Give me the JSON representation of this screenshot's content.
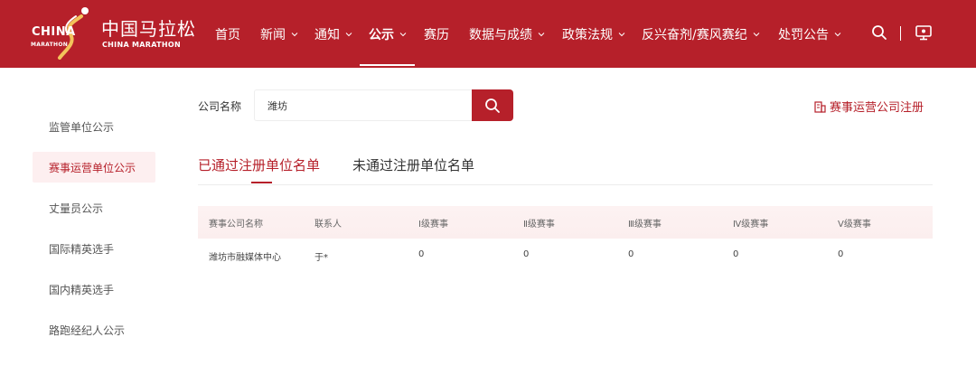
{
  "header": {
    "logo": {
      "text_top": "CHINA",
      "text_bottom": "MARATHON"
    },
    "brand_cn": "中国马拉松",
    "brand_en": "CHINA MARATHON",
    "nav": [
      {
        "label": "首页",
        "chevron": false
      },
      {
        "label": "新闻",
        "chevron": true
      },
      {
        "label": "通知",
        "chevron": true
      },
      {
        "label": "公示",
        "chevron": true,
        "active": true
      },
      {
        "label": "赛历",
        "chevron": false
      },
      {
        "label": "数据与成绩",
        "chevron": true
      },
      {
        "label": "政策法规",
        "chevron": true
      },
      {
        "label": "反兴奋剂/赛风赛纪",
        "chevron": true
      },
      {
        "label": "处罚公告",
        "chevron": true
      }
    ],
    "icons": {
      "search": "search-icon",
      "monitor": "monitor-icon"
    },
    "colors": {
      "brand": "#b6202a"
    }
  },
  "sidebar": {
    "items": [
      {
        "label": "监管单位公示"
      },
      {
        "label": "赛事运营单位公示",
        "active": true
      },
      {
        "label": "丈量员公示"
      },
      {
        "label": "国际精英选手"
      },
      {
        "label": "国内精英选手"
      },
      {
        "label": "路跑经纪人公示"
      }
    ]
  },
  "search": {
    "label": "公司名称",
    "value": "潍坊"
  },
  "register_link": "赛事运营公司注册",
  "tabs": [
    {
      "label": "已通过注册单位名单",
      "active": true
    },
    {
      "label": "未通过注册单位名单"
    }
  ],
  "table": {
    "headers": [
      "赛事公司名称",
      "联系人",
      "Ⅰ级赛事",
      "Ⅱ级赛事",
      "Ⅲ级赛事",
      "Ⅳ级赛事",
      "Ⅴ级赛事"
    ],
    "rows": [
      [
        "潍坊市融媒体中心",
        "于*",
        "0",
        "0",
        "0",
        "0",
        "0"
      ]
    ]
  }
}
